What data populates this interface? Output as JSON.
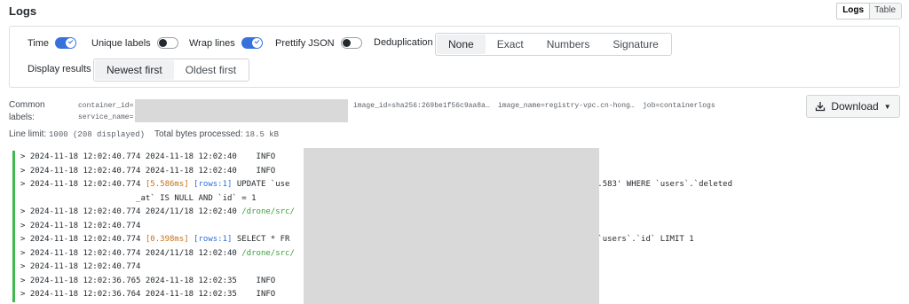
{
  "panel": {
    "title": "Logs"
  },
  "view_switch": {
    "logs": "Logs",
    "table": "Table",
    "active": "Logs"
  },
  "options": {
    "time": {
      "label": "Time",
      "on": true
    },
    "unique_labels": {
      "label": "Unique labels",
      "on": false
    },
    "wrap_lines": {
      "label": "Wrap lines",
      "on": true
    },
    "prettify_json": {
      "label": "Prettify JSON",
      "on": false
    },
    "deduplication": {
      "label": "Deduplication",
      "options": [
        "None",
        "Exact",
        "Numbers",
        "Signature"
      ],
      "selected": "None"
    },
    "display_results": {
      "label": "Display results",
      "options": [
        "Newest first",
        "Oldest first"
      ],
      "selected": "Newest first"
    }
  },
  "common_labels": {
    "title_line1": "Common",
    "title_line2": "labels:",
    "items": [
      "container_id=",
      "service_name=",
      "image_id=sha256:269be1f56c9aa8a…",
      "image_name=registry-vpc.cn-hong…",
      "job=containerlogs"
    ]
  },
  "download": {
    "label": "Download",
    "icon": "download-icon"
  },
  "meta": {
    "line_limit_label": "Line limit:",
    "line_limit_value": "1000 (208 displayed)",
    "bytes_label": "Total bytes processed:",
    "bytes_value": "18.5 kB"
  },
  "colors": {
    "accent": "#3871dc",
    "log_level_bar": "#3fb950",
    "duration": "#c4721a",
    "rows": "#2f6fd6",
    "path": "#3a9e3a"
  },
  "log_rows": [
    {
      "ts": "2024-11-18 12:02:40.774",
      "t2": "2024-11-18 12:02:40",
      "level": "INFO",
      "rest": ""
    },
    {
      "ts": "2024-11-18 12:02:40.774",
      "t2": "2024-11-18 12:02:40",
      "level": "INFO",
      "rest": ""
    },
    {
      "ts": "2024-11-18 12:02:40.774",
      "dur": "[5.586ms]",
      "rows": "[rows:1]",
      "sql_a": "UPDATE `use",
      "sql_b": "t`='2024-11-18 12:02:40.583' WHERE `users`.`deleted",
      "cont": "_at` IS NULL AND `id` = 1"
    },
    {
      "ts": "2024-11-18 12:02:40.774",
      "t2": "2024/11/18 12:02:40",
      "path": "/drone/src/"
    },
    {
      "ts": "2024-11-18 12:02:40.774"
    },
    {
      "ts": "2024-11-18 12:02:40.774",
      "dur": "[0.398ms]",
      "rows": "[rows:1]",
      "sql_a": "SELECT * FR",
      "sql_b": "IS NULL ORDER BY `users`.`id` LIMIT 1"
    },
    {
      "ts": "2024-11-18 12:02:40.774",
      "t2": "2024/11/18 12:02:40",
      "path": "/drone/src/"
    },
    {
      "ts": "2024-11-18 12:02:40.774"
    },
    {
      "ts": "2024-11-18 12:02:36.765",
      "t2": "2024-11-18 12:02:35",
      "level": "INFO",
      "rest": ""
    },
    {
      "ts": "2024-11-18 12:02:36.764",
      "t2": "2024-11-18 12:02:35",
      "level": "INFO",
      "rest": ""
    }
  ]
}
